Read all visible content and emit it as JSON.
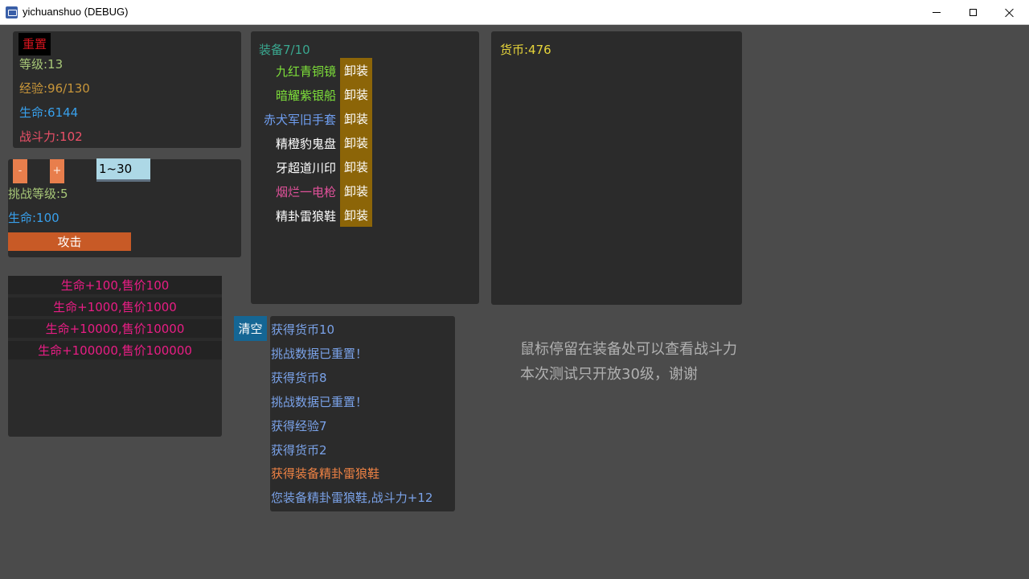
{
  "window": {
    "title": "yichuanshuo (DEBUG)",
    "icon": "app-icon"
  },
  "colors": {
    "background": "#4b4b4b",
    "panel": "#2b2b2b",
    "unequip": "#8c6508",
    "attack": "#c85a26",
    "clear": "#156694",
    "pink": "#e81d84",
    "log_blue": "#7aa2e8"
  },
  "stats": {
    "reset_label": "重置",
    "level": "等级:13",
    "exp": "经验:96/130",
    "hp": "生命:6144",
    "power": "战斗力:102"
  },
  "challenge": {
    "minus_label": "-",
    "plus_label": "+",
    "range": "1~30",
    "level": "挑战等级:5",
    "hp": "生命:100",
    "attack_label": "攻击"
  },
  "shop": {
    "items": [
      {
        "label": "生命+100,售价100"
      },
      {
        "label": "生命+1000,售价1000"
      },
      {
        "label": "生命+10000,售价10000"
      },
      {
        "label": "生命+100000,售价100000"
      }
    ]
  },
  "equipment": {
    "header": "装备7/10",
    "unequip_label": "卸装",
    "items": [
      {
        "name": "九红青铜镜",
        "color": "#7ee03a"
      },
      {
        "name": "暗耀紫银船",
        "color": "#7ee03a"
      },
      {
        "name": "赤犬军旧手套",
        "color": "#6f9ef0"
      },
      {
        "name": "精橙豹鬼盘",
        "color": "#ffffff"
      },
      {
        "name": "牙超道川印",
        "color": "#ffffff"
      },
      {
        "name": "烟烂一电枪",
        "color": "#e0519a"
      },
      {
        "name": "精卦雷狼鞋",
        "color": "#ffffff"
      }
    ]
  },
  "currency": {
    "label": "货币:476"
  },
  "log": {
    "clear_label": "清空",
    "lines": [
      {
        "text": "获得货币10",
        "color": "#7aa2e8"
      },
      {
        "text": "挑战数据已重置！",
        "color": "#7aa2e8"
      },
      {
        "text": "获得货币8",
        "color": "#7aa2e8"
      },
      {
        "text": "挑战数据已重置！",
        "color": "#7aa2e8"
      },
      {
        "text": "获得经验7",
        "color": "#7aa2e8"
      },
      {
        "text": "获得货币2",
        "color": "#7aa2e8"
      },
      {
        "text": "获得装备精卦雷狼鞋",
        "color": "#ee8244"
      },
      {
        "text": "您装备精卦雷狼鞋,战斗力+12",
        "color": "#7aa2e8"
      }
    ]
  },
  "hints": {
    "line1": "鼠标停留在装备处可以查看战斗力",
    "line2": "本次测试只开放30级，谢谢"
  }
}
